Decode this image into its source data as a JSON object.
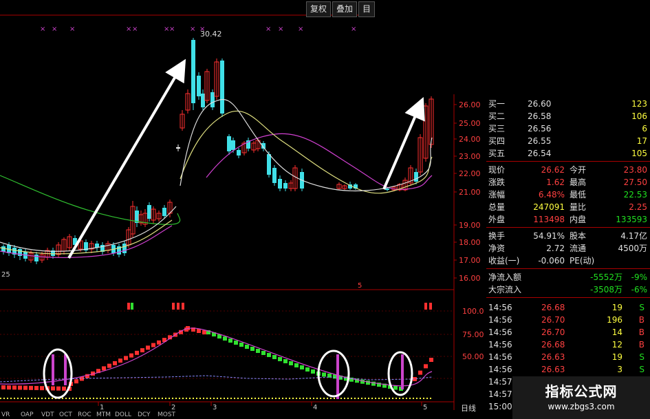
{
  "toolbar": {
    "btn1": "复权",
    "btn2": "叠加",
    "btn3": "目"
  },
  "price_axis": [
    "26.00",
    "25.00",
    "24.00",
    "23.00",
    "22.00",
    "21.00",
    "19.00",
    "18.00",
    "17.00",
    "16.00"
  ],
  "peak_label": "30.42",
  "left_low_label": "25",
  "vol_marker_top": "5",
  "indicator_axis": [
    "100.0",
    "75.00",
    "50.00"
  ],
  "x_ticks": [
    "1",
    "2",
    "3",
    "4",
    "5"
  ],
  "bottom_tabs": [
    "VR",
    "OAP",
    "VDT",
    "OCT",
    "ROC",
    "MTM",
    "DOLL",
    "DCY",
    "MOST"
  ],
  "right_tab": "日线",
  "quote": {
    "bids": [
      {
        "label": "买一",
        "price": "26.60",
        "vol": "123"
      },
      {
        "label": "买二",
        "price": "26.58",
        "vol": "106"
      },
      {
        "label": "买三",
        "price": "26.56",
        "vol": "6"
      },
      {
        "label": "买四",
        "price": "26.55",
        "vol": "17"
      },
      {
        "label": "买五",
        "price": "26.54",
        "vol": "105"
      }
    ],
    "stats": [
      {
        "l1": "现价",
        "v1": "26.62",
        "l2": "今开",
        "v2": "23.80"
      },
      {
        "l1": "涨跌",
        "v1": "1.62",
        "l2": "最高",
        "v2": "27.50"
      },
      {
        "l1": "涨幅",
        "v1": "6.48%",
        "l2": "最低",
        "v2": "22.53"
      },
      {
        "l1": "总量",
        "v1": "247091",
        "l2": "量比",
        "v2": "2.25"
      },
      {
        "l1": "外盘",
        "v1": "113498",
        "l2": "内盘",
        "v2": "133593"
      }
    ],
    "stats2": [
      {
        "l1": "换手",
        "v1": "54.91%",
        "l2": "股本",
        "v2": "4.17亿"
      },
      {
        "l1": "净资",
        "v1": "2.72",
        "l2": "流通",
        "v2": "4500万"
      },
      {
        "l1": "收益(一)",
        "v1": "-0.060",
        "l2": "PE(动)",
        "v2": ""
      }
    ],
    "flows": [
      {
        "label": "净流入额",
        "value": "-5552万",
        "pct": "-9%"
      },
      {
        "label": "大宗流入",
        "value": "-3508万",
        "pct": "-6%"
      }
    ],
    "ticks": [
      {
        "t": "14:56",
        "p": "26.68",
        "v": "19",
        "s": "S"
      },
      {
        "t": "14:56",
        "p": "26.70",
        "v": "196",
        "s": "B"
      },
      {
        "t": "14:56",
        "p": "26.70",
        "v": "14",
        "s": "B"
      },
      {
        "t": "14:56",
        "p": "26.68",
        "v": "12",
        "s": "B"
      },
      {
        "t": "14:56",
        "p": "26.63",
        "v": "19",
        "s": "S"
      },
      {
        "t": "14:56",
        "p": "26.63",
        "v": "3",
        "s": "S"
      },
      {
        "t": "14:57",
        "p": "",
        "v": "",
        "s": ""
      },
      {
        "t": "14:57",
        "p": "",
        "v": "",
        "s": ""
      },
      {
        "t": "15:00",
        "p": "",
        "v": "",
        "s": ""
      }
    ]
  },
  "watermark": {
    "title": "指标公式网",
    "url": "www.zbgs3.com"
  }
}
